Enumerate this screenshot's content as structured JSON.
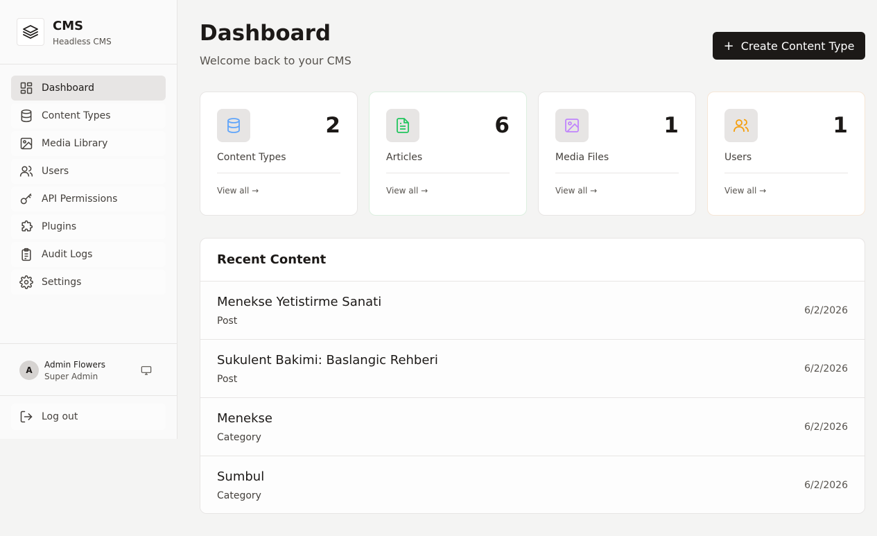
{
  "brand": {
    "title": "CMS",
    "subtitle": "Headless CMS"
  },
  "sidebar": {
    "items": [
      {
        "label": "Dashboard",
        "icon": "dashboard-icon",
        "active": true
      },
      {
        "label": "Content Types",
        "icon": "database-icon"
      },
      {
        "label": "Media Library",
        "icon": "image-icon"
      },
      {
        "label": "Users",
        "icon": "users-icon"
      },
      {
        "label": "API Permissions",
        "icon": "key-icon"
      },
      {
        "label": "Plugins",
        "icon": "puzzle-icon"
      },
      {
        "label": "Audit Logs",
        "icon": "clipboard-icon"
      },
      {
        "label": "Settings",
        "icon": "gear-icon"
      }
    ],
    "user": {
      "initial": "A",
      "name": "Admin Flowers",
      "role": "Super Admin"
    },
    "logout_label": "Log out"
  },
  "header": {
    "title": "Dashboard",
    "subtitle": "Welcome back to your CMS",
    "create_button": {
      "plus": "+",
      "label": "Create Content Type"
    }
  },
  "stats": [
    {
      "label": "Content Types",
      "value": "2",
      "link": "View all →",
      "icon": "database-icon",
      "accent": "#60a5fa"
    },
    {
      "label": "Articles",
      "value": "6",
      "link": "View all →",
      "icon": "file-text-icon",
      "accent": "#22c55e"
    },
    {
      "label": "Media Files",
      "value": "1",
      "link": "View all →",
      "icon": "image-icon",
      "accent": "#c084fc"
    },
    {
      "label": "Users",
      "value": "1",
      "link": "View all →",
      "icon": "users-icon",
      "accent": "#f59e0b"
    }
  ],
  "recent": {
    "title": "Recent Content",
    "rows": [
      {
        "title": "Menekse Yetistirme Sanati",
        "type": "Post",
        "date": "6/2/2026"
      },
      {
        "title": "Sukulent Bakimi: Baslangic Rehberi",
        "type": "Post",
        "date": "6/2/2026"
      },
      {
        "title": "Menekse",
        "type": "Category",
        "date": "6/2/2026"
      },
      {
        "title": "Sumbul",
        "type": "Category",
        "date": "6/2/2026"
      }
    ]
  },
  "colors": {
    "primary": "#1c1917",
    "background": "#f4f4f3",
    "border": "#e7e5e4"
  }
}
